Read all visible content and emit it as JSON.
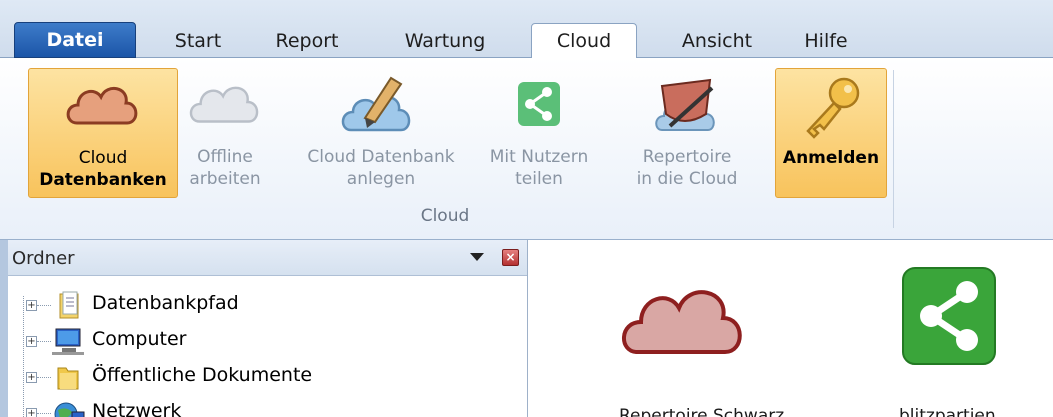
{
  "tabs": {
    "datei": "Datei",
    "start": "Start",
    "report": "Report",
    "wartung": "Wartung",
    "cloud": "Cloud",
    "ansicht": "Ansicht",
    "hilfe": "Hilfe",
    "active": "Cloud"
  },
  "ribbon": {
    "group_label": "Cloud",
    "buttons": [
      {
        "line1": "Cloud",
        "line2": "Datenbanken",
        "state": "selected",
        "icon": "cloud-icon"
      },
      {
        "line1": "Offline",
        "line2": "arbeiten",
        "state": "disabled",
        "icon": "cloud-icon"
      },
      {
        "line1": "Cloud Datenbank",
        "line2": "anlegen",
        "state": "disabled",
        "icon": "cloud-pencil-icon"
      },
      {
        "line1": "Mit Nutzern",
        "line2": "teilen",
        "state": "disabled",
        "icon": "share-icon"
      },
      {
        "line1": "Repertoire",
        "line2": "in die Cloud",
        "state": "disabled",
        "icon": "repertoire-icon"
      },
      {
        "line1": "Anmelden",
        "line2": "",
        "state": "selected",
        "icon": "key-icon"
      }
    ]
  },
  "folder_pane": {
    "title": "Ordner",
    "items": [
      {
        "label": "Datenbankpfad",
        "icon": "folder-doc-icon"
      },
      {
        "label": "Computer",
        "icon": "computer-icon"
      },
      {
        "label": "Öffentliche Dokumente",
        "icon": "folder-icon"
      },
      {
        "label": "Netzwerk",
        "icon": "network-icon"
      }
    ]
  },
  "content": {
    "items": [
      {
        "label": "Repertoire Schwarz",
        "icon": "cloud-icon"
      },
      {
        "label": "blitzpartien",
        "icon": "share-icon"
      }
    ]
  },
  "colors": {
    "selected_button": "#f8c35c",
    "datei_tab": "#1b55a8",
    "cloud_fill": "#d9a7a4",
    "share_green": "#3aa53a"
  }
}
